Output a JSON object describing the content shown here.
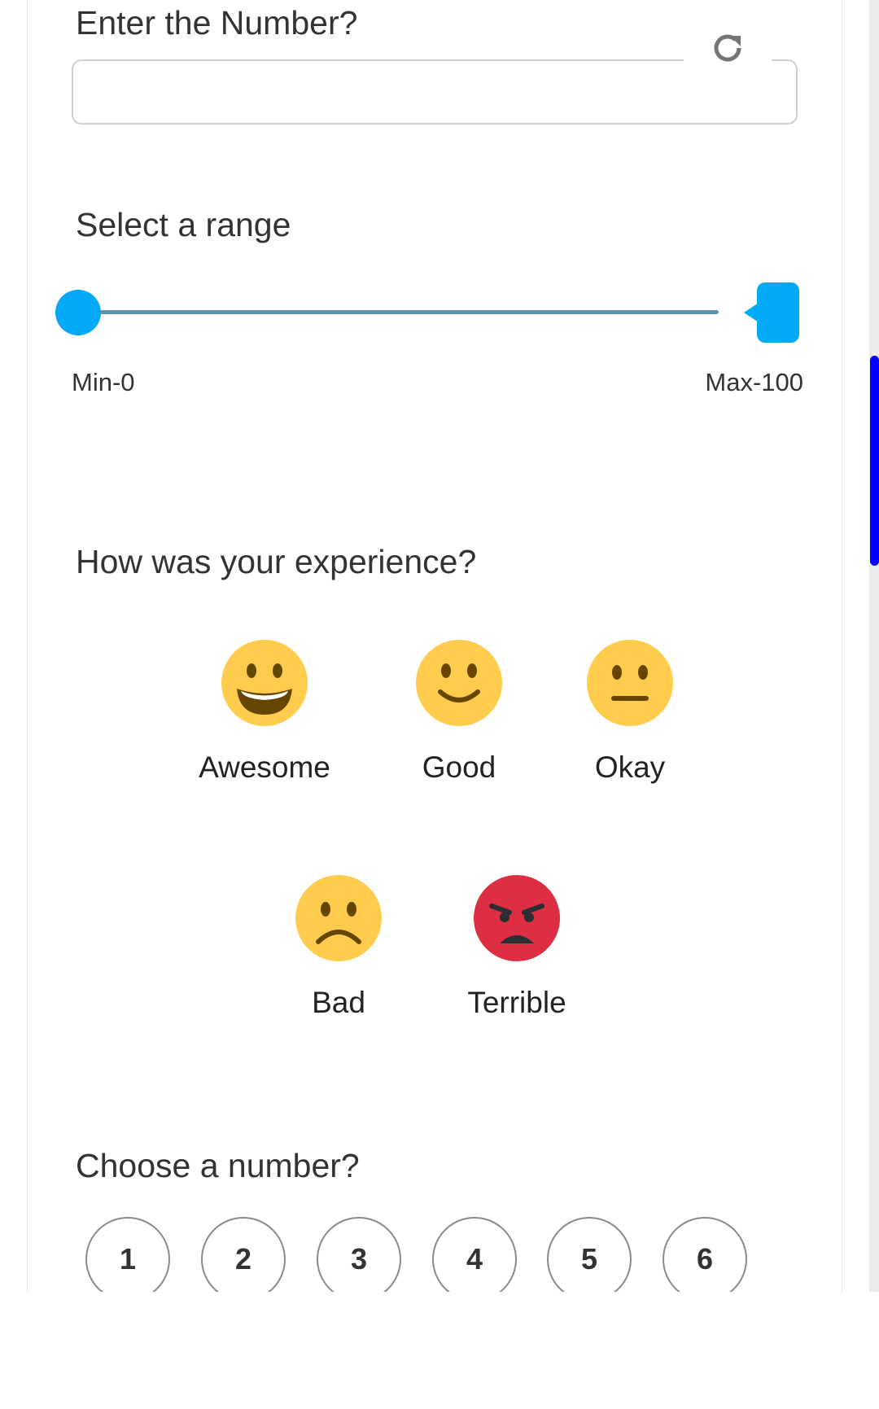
{
  "number_question": {
    "label": "Enter the Number?",
    "value": "",
    "refresh_icon": "refresh-icon"
  },
  "range_question": {
    "label": "Select a range",
    "min_label": "Min-0",
    "max_label": "Max-100",
    "min_value": 0,
    "max_value": 100
  },
  "experience_question": {
    "label": "How was your experience?",
    "options": [
      {
        "label": "Awesome",
        "icon": "grinning-face-icon",
        "color": "#FFCC4D"
      },
      {
        "label": "Good",
        "icon": "slightly-smiling-face-icon",
        "color": "#FFCC4D"
      },
      {
        "label": "Okay",
        "icon": "neutral-face-icon",
        "color": "#FFCC4D"
      },
      {
        "label": "Bad",
        "icon": "frowning-face-icon",
        "color": "#FFCC4D"
      },
      {
        "label": "Terrible",
        "icon": "angry-face-icon",
        "color": "#DD2E44"
      }
    ]
  },
  "number_choice_question": {
    "label": "Choose a number?",
    "options": [
      "1",
      "2",
      "3",
      "4",
      "5",
      "6"
    ]
  },
  "colors": {
    "accent": "#03A9F4",
    "track": "#5B94B3",
    "scrollbar_thumb": "#0000FF"
  }
}
